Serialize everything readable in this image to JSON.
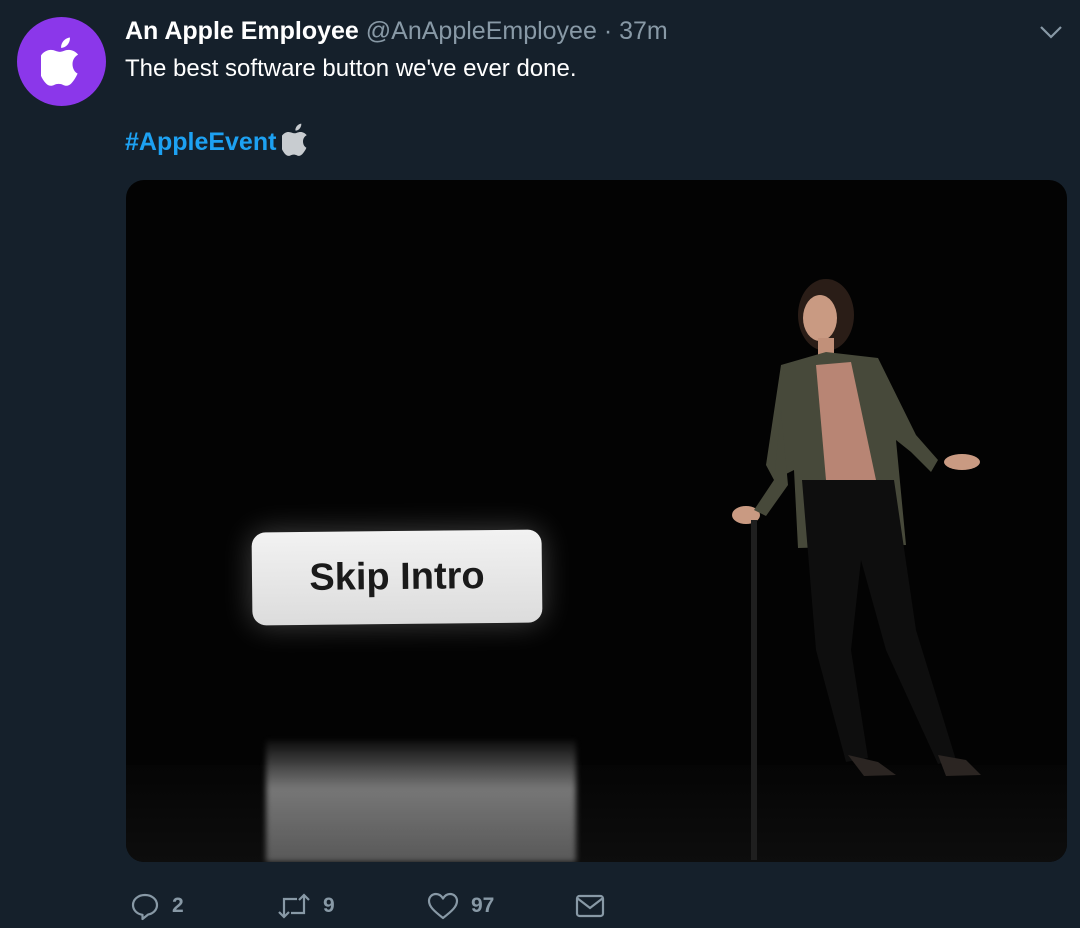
{
  "tweet": {
    "display_name": "An Apple Employee",
    "handle": "@AnAppleEmployee",
    "separator": "·",
    "time": "37m",
    "text": "The best software button we've ever done.",
    "hashtag": "#AppleEvent",
    "hashtag_emoji_icon": "apple-logo-icon"
  },
  "avatar": {
    "icon": "apple-logo-icon",
    "color": "#8b37ea"
  },
  "media": {
    "button_text": "Skip Intro"
  },
  "actions": {
    "reply_count": "2",
    "retweet_count": "9",
    "like_count": "97"
  },
  "colors": {
    "background": "#15202b",
    "secondary_text": "#8899a6",
    "link": "#1da1f2"
  }
}
